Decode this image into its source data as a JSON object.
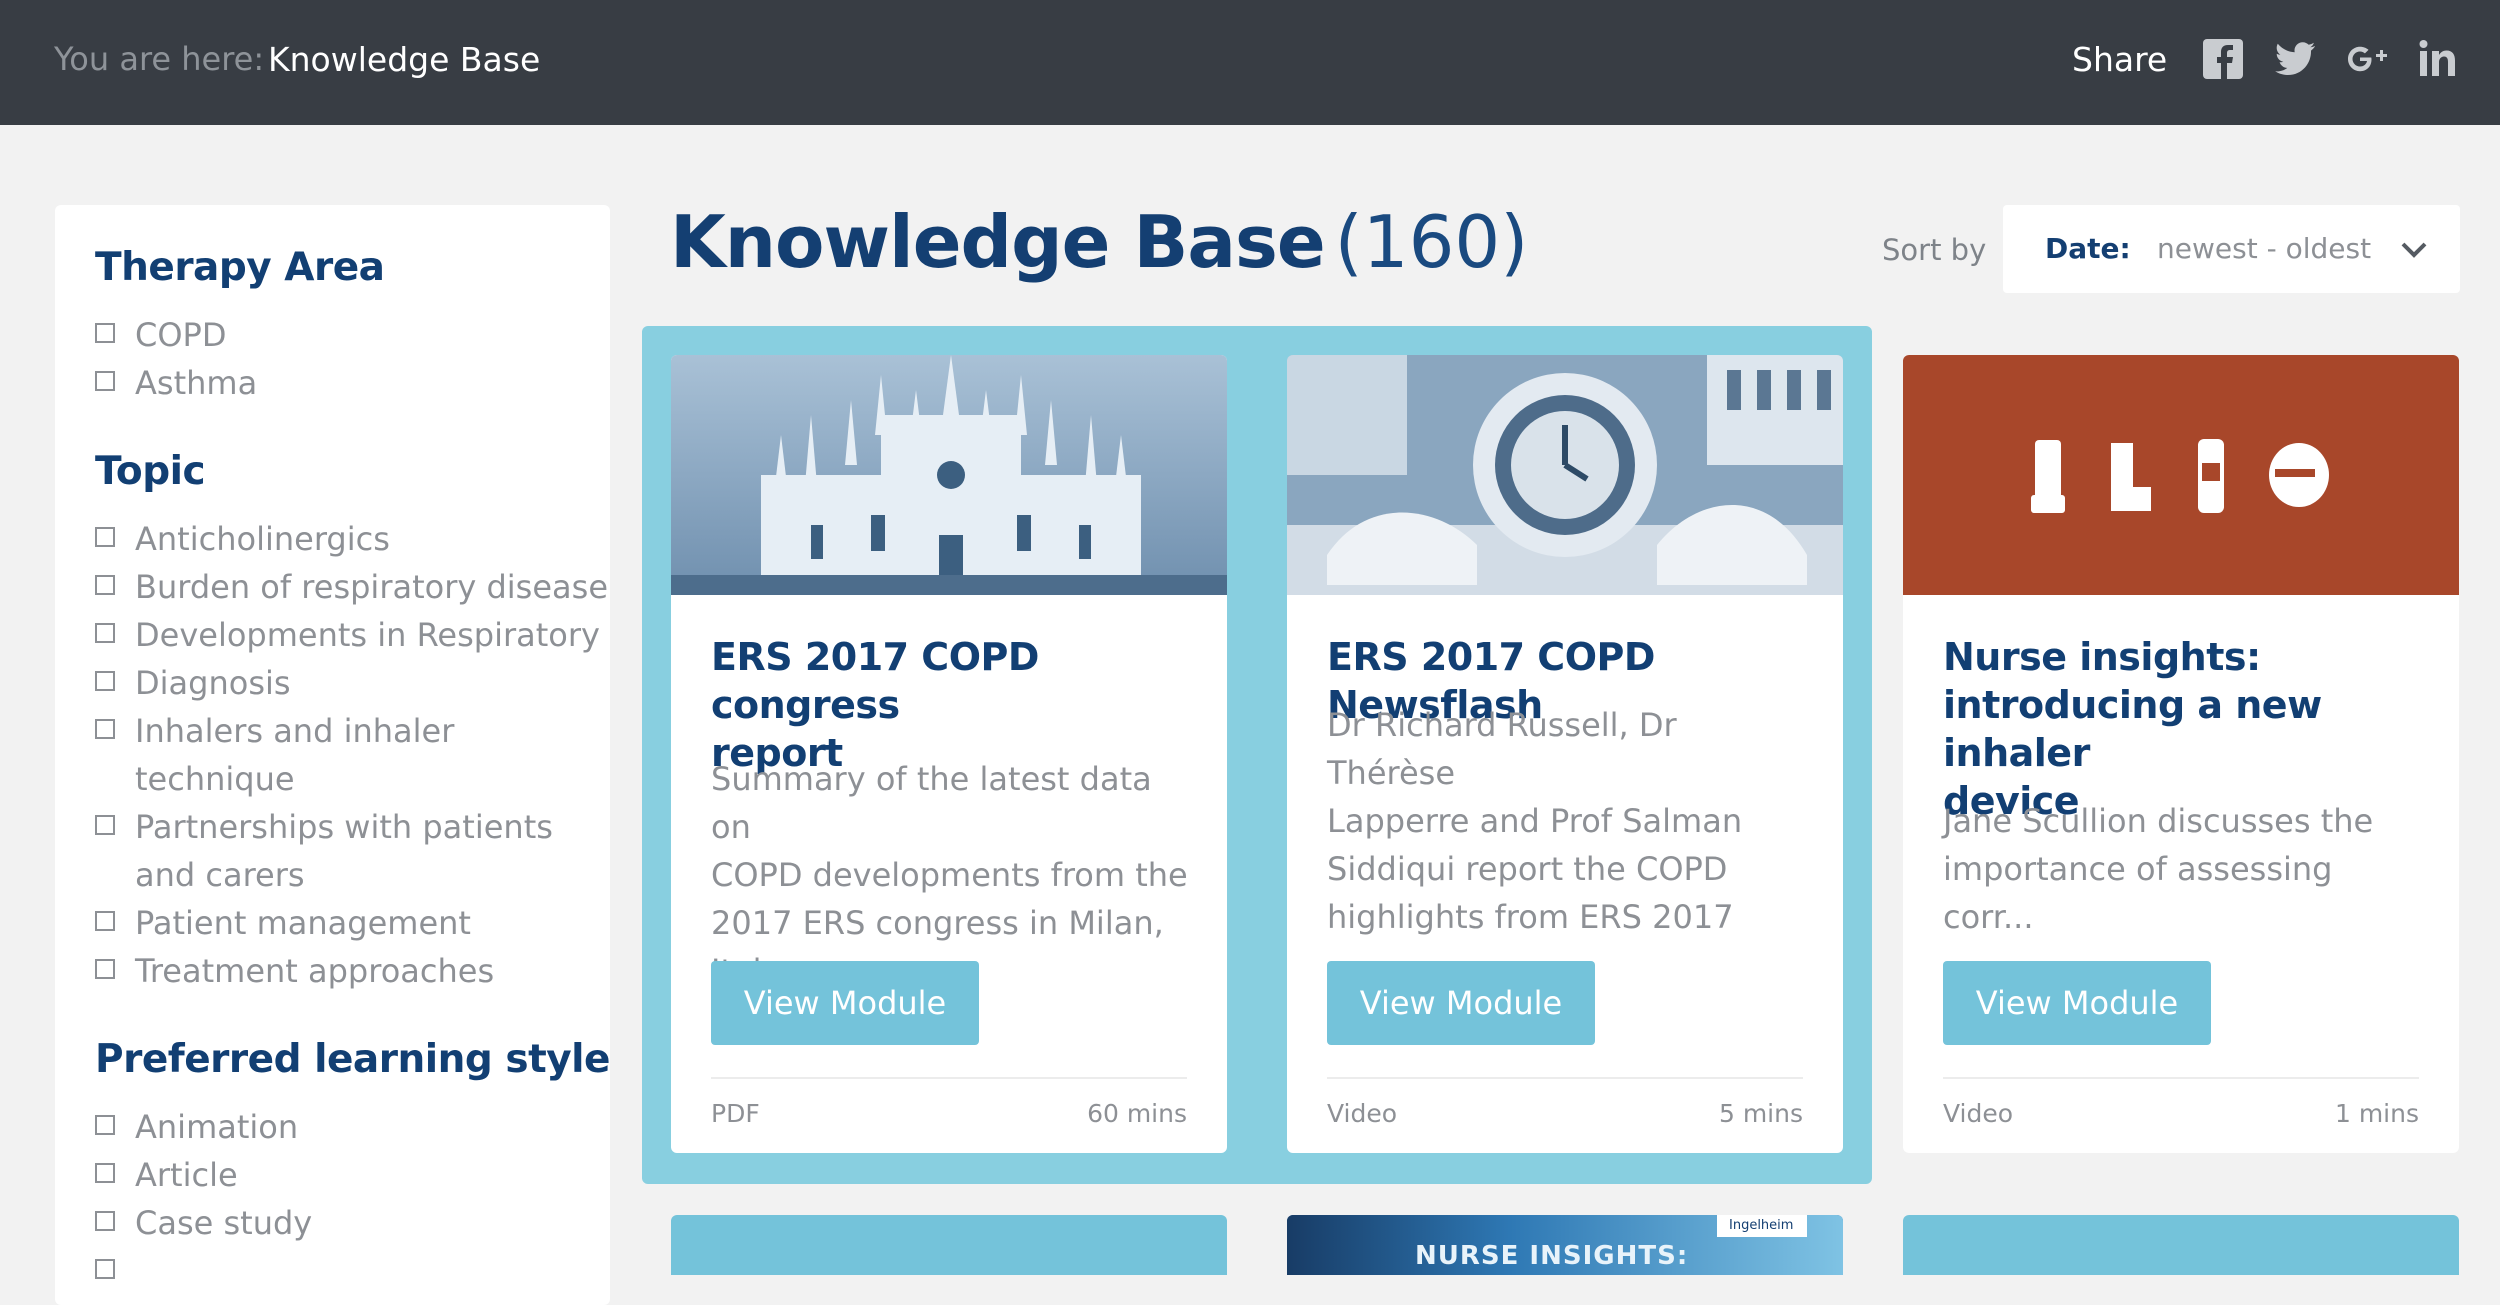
{
  "breadcrumb": {
    "label": "You are here:",
    "current": "Knowledge Base"
  },
  "share": {
    "label": "Share",
    "icons": [
      "facebook-icon",
      "twitter-icon",
      "google-plus-icon",
      "linkedin-icon"
    ]
  },
  "page": {
    "title": "Knowledge Base",
    "count": "(160)"
  },
  "sort": {
    "label": "Sort by",
    "key": "Date:",
    "value": "newest - oldest"
  },
  "filters": {
    "therapy_area": {
      "title": "Therapy Area",
      "items": [
        "COPD",
        "Asthma"
      ]
    },
    "topic": {
      "title": "Topic",
      "items": [
        "Anticholinergics",
        "Burden of respiratory disease",
        "Developments in Respiratory",
        "Diagnosis",
        "Inhalers and inhaler",
        "technique",
        "Partnerships with patients",
        "and carers",
        "Patient management",
        "Treatment approaches"
      ]
    },
    "learning_style": {
      "title": "Preferred learning style",
      "items": [
        "Animation",
        "Article",
        "Case study"
      ]
    }
  },
  "cards": [
    {
      "title_lines": [
        "ERS 2017 COPD congress",
        "report"
      ],
      "desc_lines": [
        "Summary of the latest data on",
        "COPD developments from the",
        "2017 ERS congress in Milan, Italy"
      ],
      "button": "View Module",
      "type": "PDF",
      "duration": "60 mins"
    },
    {
      "title_lines": [
        "ERS 2017 COPD Newsflash"
      ],
      "desc_lines": [
        "Dr Richard Russell, Dr Thérèse",
        "Lapperre and Prof Salman",
        "Siddiqui report the COPD",
        "highlights from ERS 2017"
      ],
      "button": "View Module",
      "type": "Video",
      "duration": "5 mins"
    },
    {
      "title_lines": [
        "Nurse insights:",
        "introducing a new inhaler",
        "device"
      ],
      "desc_lines": [
        "Jane Scullion discusses the",
        "importance of assessing corr..."
      ],
      "button": "View Module",
      "type": "Video",
      "duration": "1 mins"
    }
  ],
  "stub": {
    "text": "NURSE INSIGHTS:",
    "brand": "Ingelheim"
  },
  "colors": {
    "topbar": "#383d44",
    "navy": "#123f73",
    "accent": "#74c3da",
    "highlight": "#88cfe0",
    "orange": "#a8472a"
  }
}
